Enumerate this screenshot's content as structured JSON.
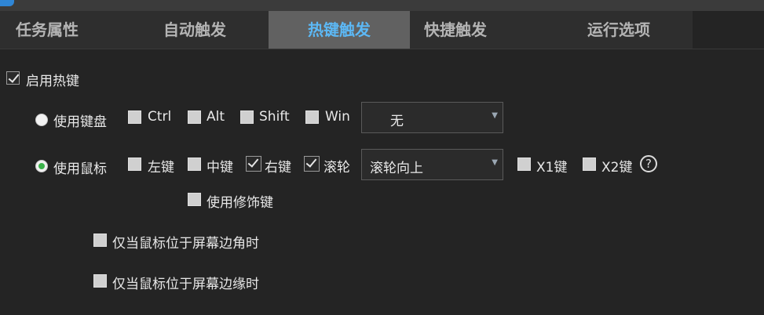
{
  "tabs": [
    {
      "label": "任务属性"
    },
    {
      "label": "自动触发"
    },
    {
      "label": "热键触发"
    },
    {
      "label": "快捷触发"
    },
    {
      "label": "运行选项"
    }
  ],
  "enable_hotkey": {
    "label": "启用热键",
    "checked": true
  },
  "keyboard": {
    "radio_label": "使用键盘",
    "mods": [
      {
        "label": "Ctrl"
      },
      {
        "label": "Alt"
      },
      {
        "label": "Shift"
      },
      {
        "label": "Win"
      }
    ],
    "key_select": {
      "value": "无"
    }
  },
  "mouse": {
    "radio_label": "使用鼠标",
    "buttons": [
      {
        "label": "左键"
      },
      {
        "label": "中键"
      },
      {
        "label": "右键"
      },
      {
        "label": "滚轮"
      }
    ],
    "wheel_select": {
      "value": "滚轮向上"
    },
    "extra": [
      {
        "label": "X1键"
      },
      {
        "label": "X2键"
      }
    ],
    "help": "?",
    "use_modifiers": {
      "label": "使用修饰键"
    }
  },
  "options": [
    {
      "label": "仅当鼠标位于屏幕边角时"
    },
    {
      "label": "仅当鼠标位于屏幕边缘时"
    }
  ]
}
